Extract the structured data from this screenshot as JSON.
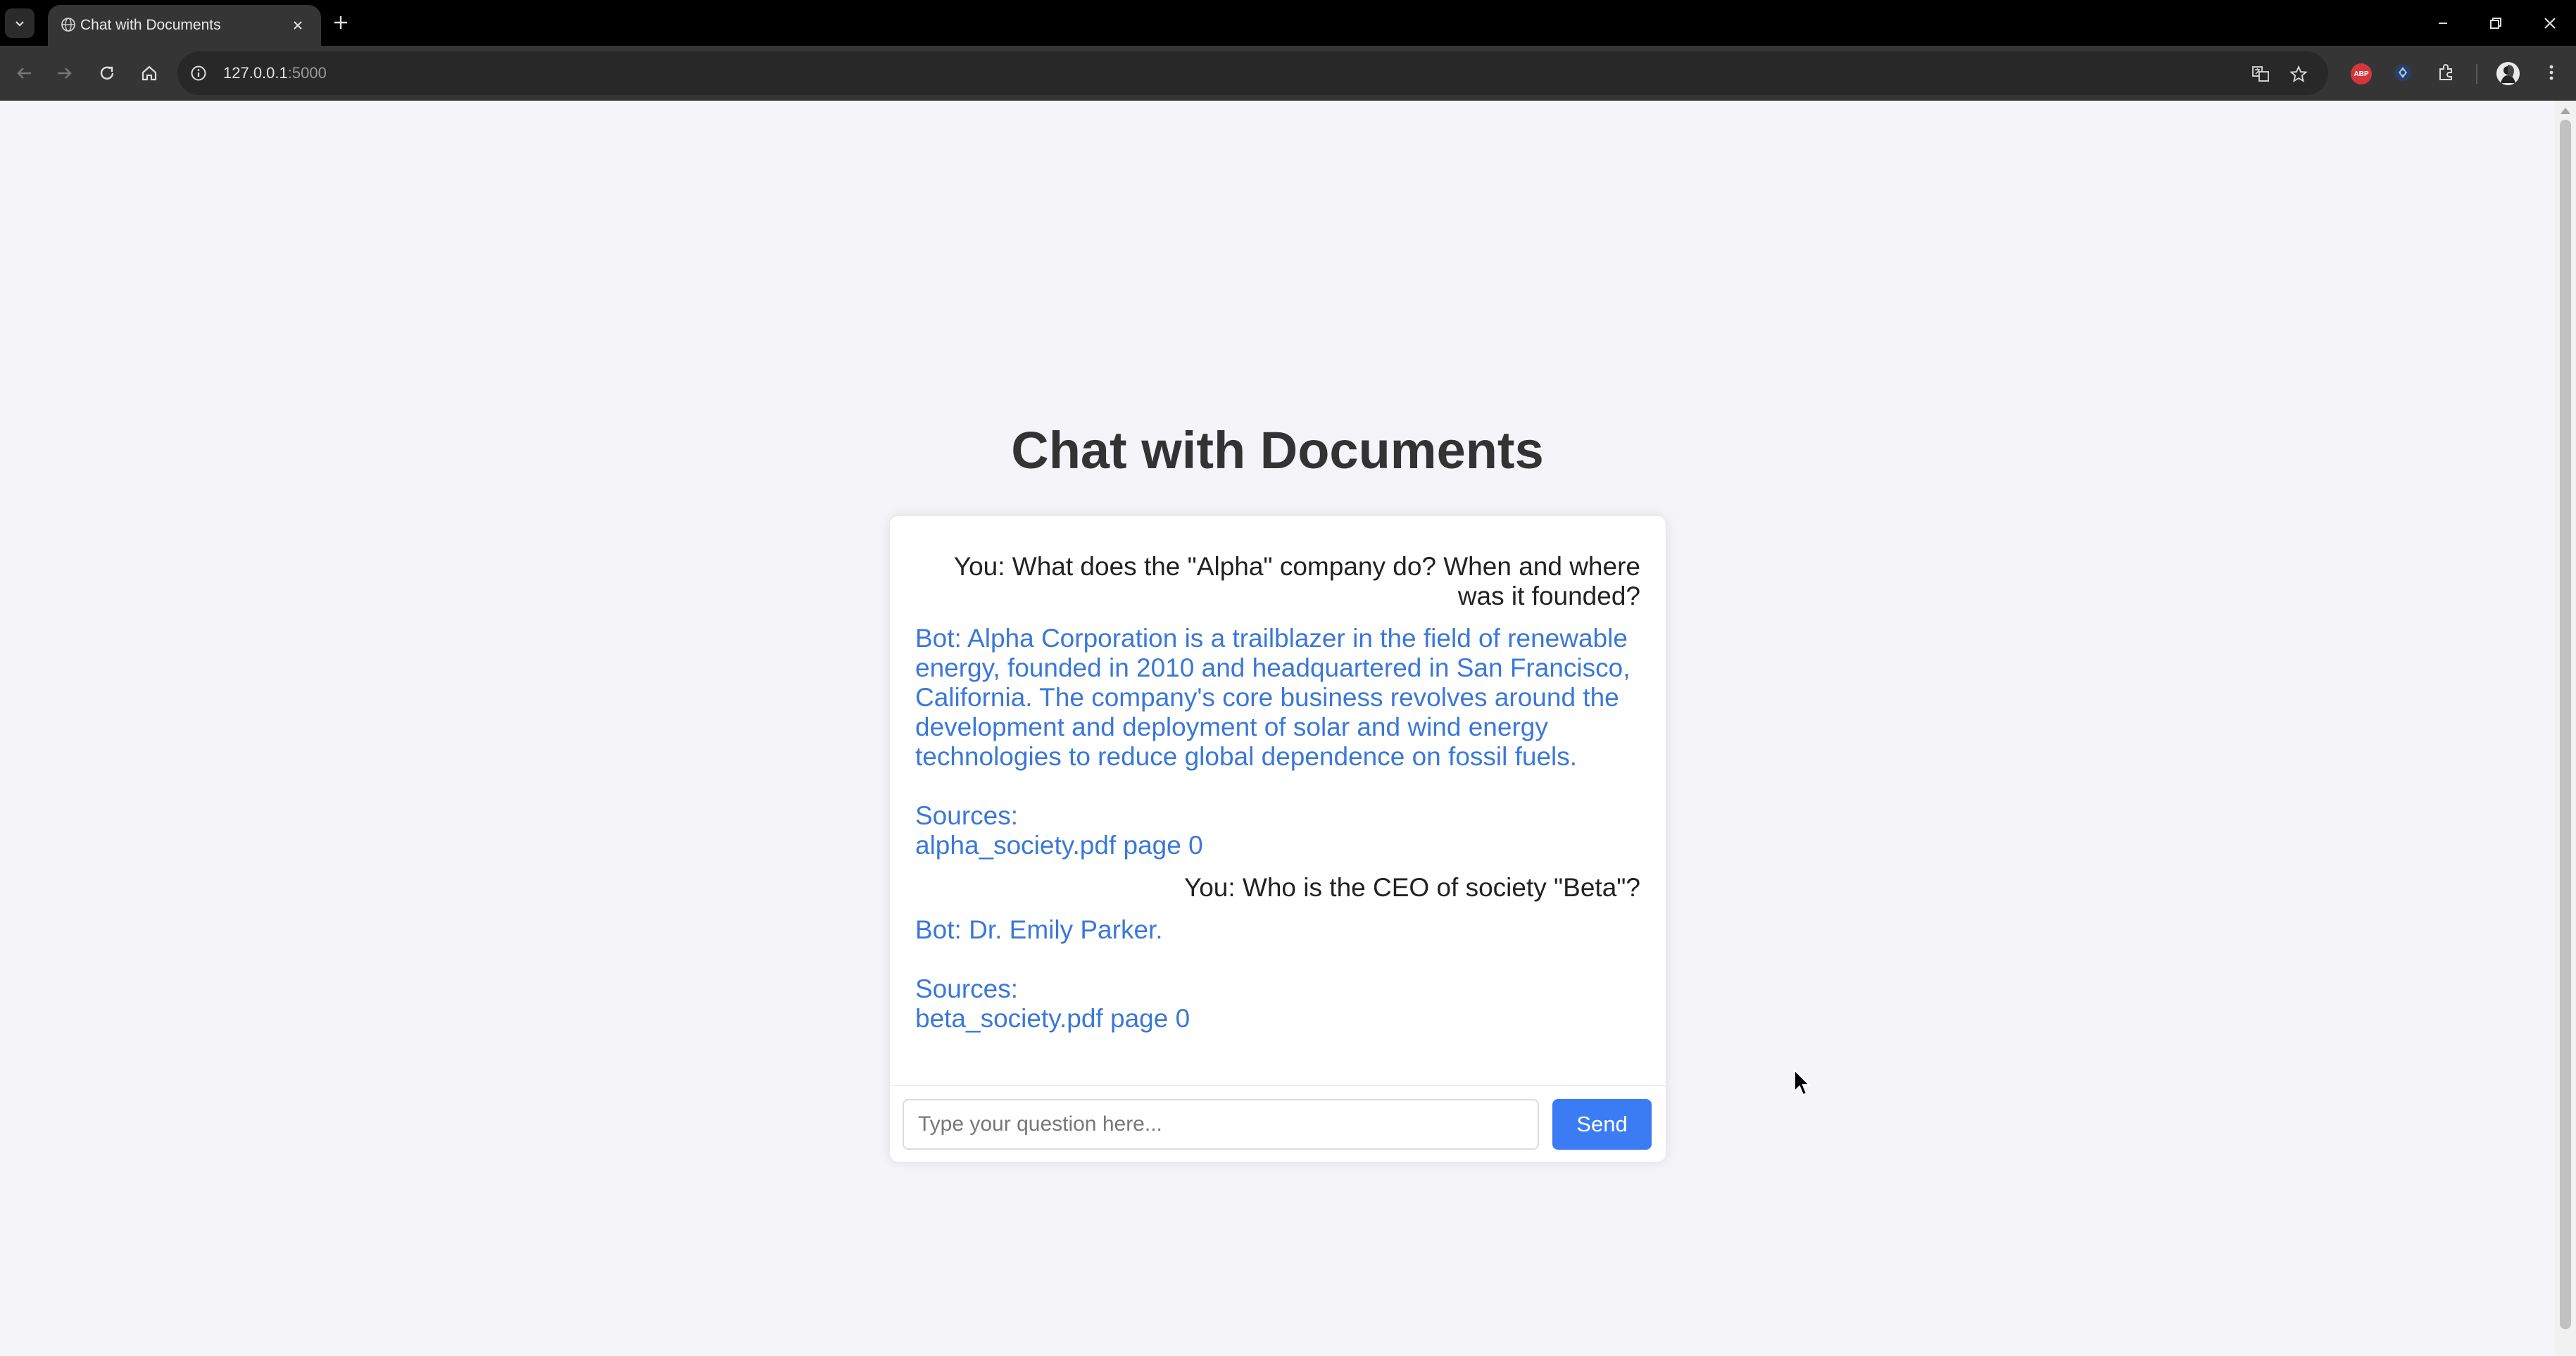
{
  "browser": {
    "tab_title": "Chat with Documents",
    "url_host": "127.0.0.1",
    "url_port": ":5000"
  },
  "page": {
    "title": "Chat with Documents"
  },
  "chat": {
    "messages": [
      {
        "role": "user",
        "text": "You: What does the \"Alpha\" company do? When and where\nwas it founded?"
      },
      {
        "role": "bot",
        "text": "Bot: Alpha Corporation is a trailblazer in the field of renewable\nenergy, founded in 2010 and headquartered in San Francisco,\nCalifornia. The company's core business revolves around the\ndevelopment and deployment of solar and wind energy\ntechnologies to reduce global dependence on fossil fuels.\n\nSources:\nalpha_society.pdf page 0"
      },
      {
        "role": "user",
        "text": "You: Who is the CEO of society \"Beta\"?"
      },
      {
        "role": "bot",
        "text": "Bot: Dr. Emily Parker.\n\nSources:\nbeta_society.pdf page 0"
      }
    ]
  },
  "input": {
    "placeholder": "Type your question here...",
    "value": "",
    "send_label": "Send"
  },
  "extensions": {
    "abp_label": "ABP"
  },
  "colors": {
    "accent": "#3b7cf4",
    "bot_text": "#3a78d8",
    "page_bg": "#f4f4f9"
  }
}
